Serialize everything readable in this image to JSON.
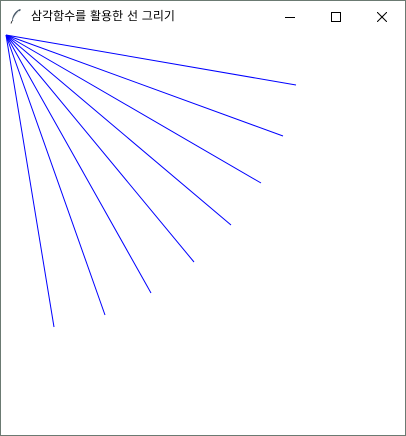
{
  "window": {
    "title": "삼각함수를 활용한 선 그리기"
  },
  "titlebar_icons": {
    "app": "feather-icon",
    "minimize": "minimize-icon",
    "maximize": "maximize-icon",
    "close": "close-icon"
  },
  "drawing": {
    "line_color": "#0000ff",
    "line_count": 8
  }
}
